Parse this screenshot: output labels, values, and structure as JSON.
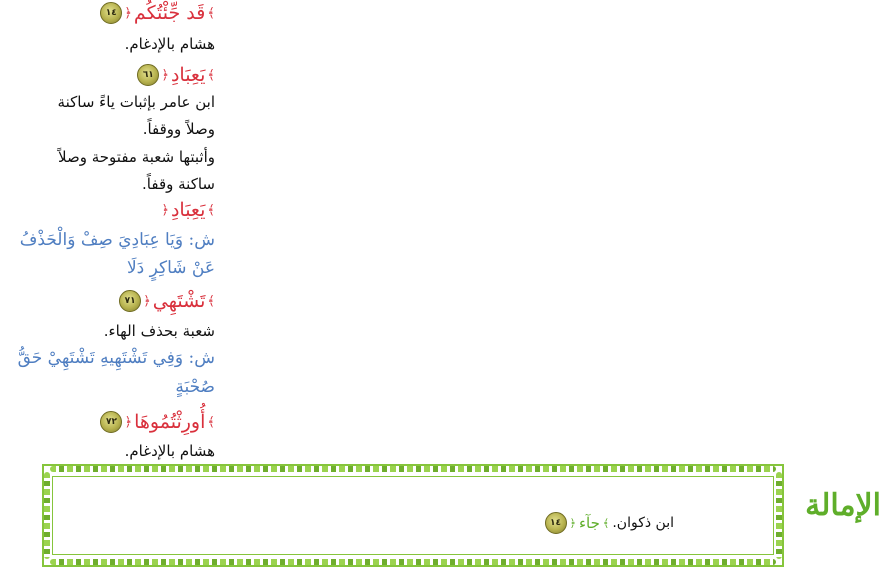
{
  "entries": [
    {
      "number": "١٤",
      "word": "قَد جِّئْتُكُم",
      "notes": [
        "هشام بالإدغام."
      ]
    },
    {
      "number": "٦١",
      "word": "يَعِبَادِ",
      "notes": [
        "ابن عامر بإثبات ياءً ساكنة",
        "وصلاً ووقفاً.",
        "وأثبتها شعبة مفتوحة وصلاً",
        "ساكنة وقفاً."
      ]
    },
    {
      "number": "",
      "word": "يَعِبَادِ",
      "verse": [
        "ش: وَيَا عِبَادِيَ صِفْ وَالْحَذْفُ",
        "عَنْ شَاكِرٍ دَلَا"
      ]
    },
    {
      "number": "٧١",
      "word": "تَشْتَهِي",
      "notes": [
        "شعبة بحذف الهاء."
      ],
      "verse": [
        "ش: وَفِي تَشْتَهِيهِ تَشْتَهِيْ حَقُّ",
        "صُحْبَةٍ"
      ]
    },
    {
      "number": "٧٢",
      "word": "أُورِثْتُمُوهَا",
      "notes": [
        "هشام بالإدغام."
      ]
    }
  ],
  "imala": {
    "title": "الإمالة",
    "number": "١٤",
    "word": "جآء",
    "note": "ابن ذكوان."
  },
  "colors": {
    "word": "#d9303c",
    "verse": "#4f7ec1",
    "frame": "#86c53c",
    "badge": "#b7b24e"
  }
}
